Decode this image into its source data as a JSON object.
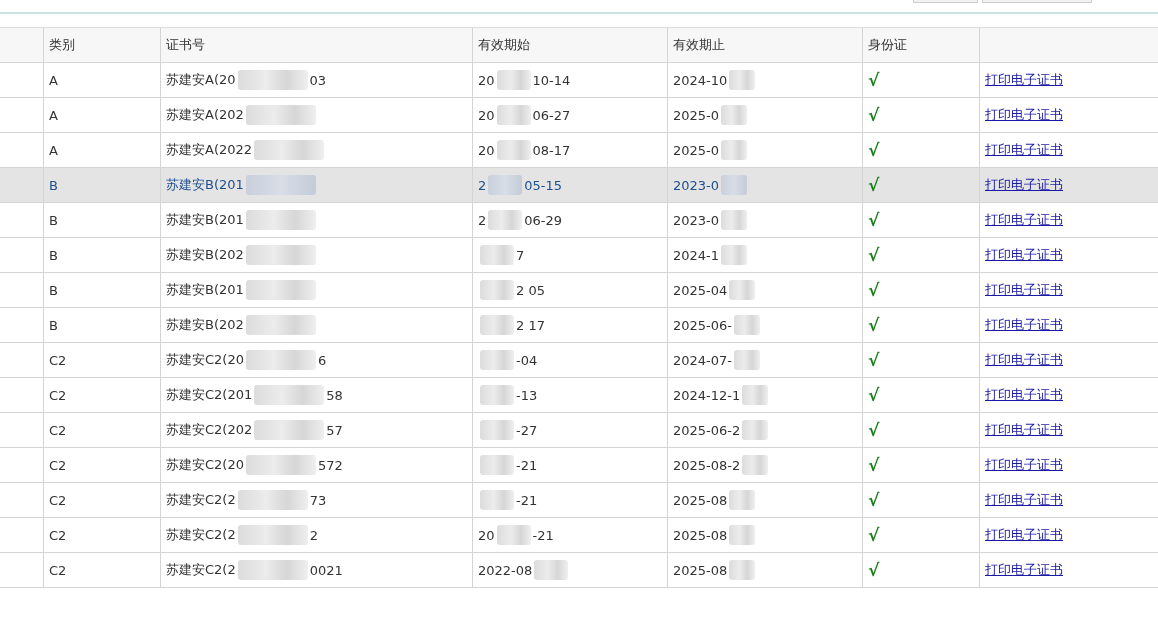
{
  "table": {
    "columns": [
      "类别",
      "证书号",
      "有效期始",
      "有效期止",
      "身份证"
    ],
    "rows": [
      {
        "selected": false,
        "category": "A",
        "cert": {
          "lead": "苏建安A(20",
          "tail": "03"
        },
        "start": {
          "lead": "20",
          "tail": "10-14"
        },
        "end": {
          "lead": "2024-10"
        },
        "id_card": "√",
        "link": "打印电子证书"
      },
      {
        "selected": false,
        "category": "A",
        "cert": {
          "lead": "苏建安A(202"
        },
        "start": {
          "lead": "20",
          "tail": "06-27"
        },
        "end": {
          "lead": "2025-0"
        },
        "id_card": "√",
        "link": "打印电子证书"
      },
      {
        "selected": false,
        "category": "A",
        "cert": {
          "lead": "苏建安A(2022"
        },
        "start": {
          "lead": "20",
          "tail": "08-17"
        },
        "end": {
          "lead": "2025-0"
        },
        "id_card": "√",
        "link": "打印电子证书"
      },
      {
        "selected": true,
        "category": "B",
        "cert": {
          "lead": "苏建安B(201"
        },
        "start": {
          "lead": "2",
          "tail": "05-15"
        },
        "end": {
          "lead": "2023-0"
        },
        "id_card": "√",
        "link": "打印电子证书"
      },
      {
        "selected": false,
        "category": "B",
        "cert": {
          "lead": "苏建安B(201"
        },
        "start": {
          "lead": "2",
          "tail": "06-29"
        },
        "end": {
          "lead": "2023-0"
        },
        "id_card": "√",
        "link": "打印电子证书"
      },
      {
        "selected": false,
        "category": "B",
        "cert": {
          "lead": "苏建安B(202"
        },
        "start": {
          "tail": "7"
        },
        "end": {
          "lead": "2024-1"
        },
        "id_card": "√",
        "link": "打印电子证书"
      },
      {
        "selected": false,
        "category": "B",
        "cert": {
          "lead": "苏建安B(201"
        },
        "start": {
          "tail": "2 05"
        },
        "end": {
          "lead": "2025-04"
        },
        "id_card": "√",
        "link": "打印电子证书"
      },
      {
        "selected": false,
        "category": "B",
        "cert": {
          "lead": "苏建安B(202"
        },
        "start": {
          "tail": "2 17"
        },
        "end": {
          "lead": "2025-06-"
        },
        "id_card": "√",
        "link": "打印电子证书"
      },
      {
        "selected": false,
        "category": "C2",
        "cert": {
          "lead": "苏建安C2(20",
          "tail": "6"
        },
        "start": {
          "tail": "-04"
        },
        "end": {
          "lead": "2024-07-"
        },
        "id_card": "√",
        "link": "打印电子证书"
      },
      {
        "selected": false,
        "category": "C2",
        "cert": {
          "lead": "苏建安C2(201",
          "tail": "58"
        },
        "start": {
          "tail": "-13"
        },
        "end": {
          "lead": "2024-12-1"
        },
        "id_card": "√",
        "link": "打印电子证书"
      },
      {
        "selected": false,
        "category": "C2",
        "cert": {
          "lead": "苏建安C2(202",
          "tail": "57"
        },
        "start": {
          "tail": "-27"
        },
        "end": {
          "lead": "2025-06-2"
        },
        "id_card": "√",
        "link": "打印电子证书"
      },
      {
        "selected": false,
        "category": "C2",
        "cert": {
          "lead": "苏建安C2(20",
          "tail": "572"
        },
        "start": {
          "tail": "-21"
        },
        "end": {
          "lead": "2025-08-2"
        },
        "id_card": "√",
        "link": "打印电子证书"
      },
      {
        "selected": false,
        "category": "C2",
        "cert": {
          "lead": "苏建安C2(2",
          "tail": "73"
        },
        "start": {
          "tail": "-21"
        },
        "end": {
          "lead": "2025-08"
        },
        "id_card": "√",
        "link": "打印电子证书"
      },
      {
        "selected": false,
        "category": "C2",
        "cert": {
          "lead": "苏建安C2(2",
          "tail": "2"
        },
        "start": {
          "lead": "20",
          "tail": "-21"
        },
        "end": {
          "lead": "2025-08"
        },
        "id_card": "√",
        "link": "打印电子证书"
      },
      {
        "selected": false,
        "category": "C2",
        "cert": {
          "lead": "苏建安C2(2",
          "tail": "0021"
        },
        "start": {
          "lead": "2022-08"
        },
        "end": {
          "lead": "2025-08"
        },
        "id_card": "√",
        "link": "打印电子证书"
      }
    ]
  }
}
